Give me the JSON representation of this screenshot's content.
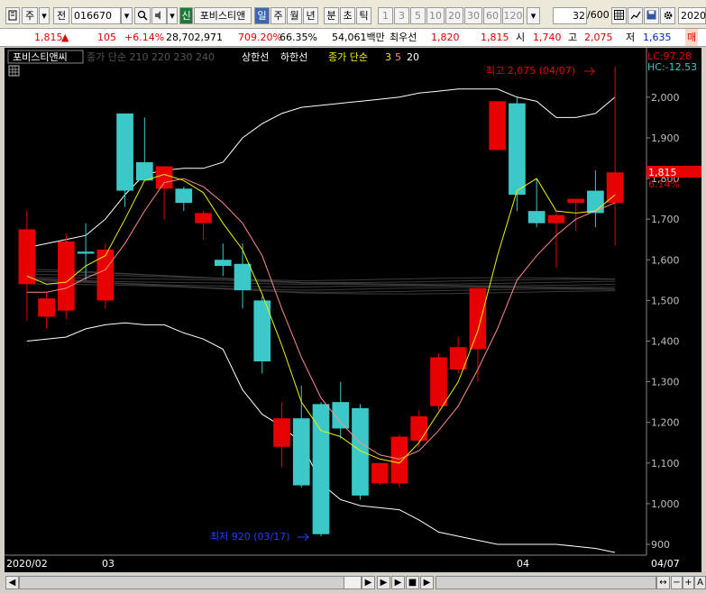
{
  "toolbar": {
    "market": "주",
    "type": "전",
    "code": "016670",
    "badge": "신",
    "name": "포비스티앤",
    "periods": [
      "일",
      "주",
      "월",
      "년",
      "분",
      "초",
      "틱"
    ],
    "minutes": [
      "1",
      "3",
      "5",
      "10",
      "20",
      "30",
      "60",
      "120"
    ],
    "count": "32",
    "count_total": "/600",
    "date": "2020"
  },
  "quote": {
    "price": "1,815",
    "arrow": "▲",
    "change": "105",
    "change_pct": "+6.14%",
    "volume": "28,702,971",
    "volume_pct": "709.20%",
    "ratio": "66.35%",
    "amount": "54,061백만",
    "best_ask_label": "최우선",
    "best_ask": "1,820",
    "best_bid": "1,815",
    "open_label": "시",
    "open": "1,740",
    "high_label": "고",
    "high": "2,075",
    "low_label": "저",
    "low": "1,635",
    "extra": "매"
  },
  "chart": {
    "legend_title": "포비스티앤씨",
    "legend_sma": "종가 단순 210 220 230 240",
    "legend_limit_up": "상한선",
    "legend_limit_down": "하한선",
    "legend_ma_label": "종가 단순",
    "legend_ma_periods": [
      "3",
      "5",
      "20"
    ],
    "lc": "LC:97.28",
    "hc": "HC:-12.53",
    "hi_note": "최고 2,075 (04/07)",
    "lo_note": "최저 920 (03/17)",
    "cur_price": "1,815",
    "cur_pct": "6.14%",
    "x_labels": [
      "2020/02",
      "03",
      "04",
      "04/07"
    ]
  },
  "colors": {
    "up": "#e60000",
    "down": "#3cc8c8",
    "ma3": "#f0f000",
    "ma5": "#ff8a8a",
    "band": "#ffffff",
    "axis": "#bfbfbf"
  },
  "chart_data": {
    "type": "candlestick",
    "y_ticks": [
      900,
      1000,
      1100,
      1200,
      1300,
      1400,
      1500,
      1600,
      1700,
      1800,
      1900,
      2000
    ],
    "y_range": [
      880,
      2095
    ],
    "candles": [
      {
        "o": 1540,
        "h": 1720,
        "l": 1450,
        "c": 1675
      },
      {
        "o": 1460,
        "h": 1520,
        "l": 1430,
        "c": 1505
      },
      {
        "o": 1475,
        "h": 1665,
        "l": 1455,
        "c": 1645
      },
      {
        "o": 1620,
        "h": 1690,
        "l": 1550,
        "c": 1615
      },
      {
        "o": 1500,
        "h": 1640,
        "l": 1480,
        "c": 1625
      },
      {
        "o": 1960,
        "h": 1960,
        "l": 1730,
        "c": 1770
      },
      {
        "o": 1840,
        "h": 1950,
        "l": 1800,
        "c": 1795
      },
      {
        "o": 1775,
        "h": 1830,
        "l": 1700,
        "c": 1830
      },
      {
        "o": 1775,
        "h": 1780,
        "l": 1720,
        "c": 1740
      },
      {
        "o": 1690,
        "h": 1720,
        "l": 1650,
        "c": 1715
      },
      {
        "o": 1600,
        "h": 1640,
        "l": 1560,
        "c": 1585
      },
      {
        "o": 1590,
        "h": 1640,
        "l": 1480,
        "c": 1525
      },
      {
        "o": 1500,
        "h": 1510,
        "l": 1320,
        "c": 1350
      },
      {
        "o": 1140,
        "h": 1250,
        "l": 1090,
        "c": 1210
      },
      {
        "o": 1210,
        "h": 1290,
        "l": 1040,
        "c": 1045
      },
      {
        "o": 1245,
        "h": 1250,
        "l": 920,
        "c": 925
      },
      {
        "o": 1250,
        "h": 1300,
        "l": 1160,
        "c": 1185
      },
      {
        "o": 1235,
        "h": 1245,
        "l": 1010,
        "c": 1020
      },
      {
        "o": 1050,
        "h": 1100,
        "l": 1045,
        "c": 1100
      },
      {
        "o": 1050,
        "h": 1170,
        "l": 1040,
        "c": 1165
      },
      {
        "o": 1155,
        "h": 1230,
        "l": 1140,
        "c": 1215
      },
      {
        "o": 1240,
        "h": 1370,
        "l": 1230,
        "c": 1360
      },
      {
        "o": 1330,
        "h": 1410,
        "l": 1320,
        "c": 1385
      },
      {
        "o": 1380,
        "h": 1530,
        "l": 1300,
        "c": 1530
      },
      {
        "o": 1870,
        "h": 1990,
        "l": 1870,
        "c": 1990
      },
      {
        "o": 1985,
        "h": 2000,
        "l": 1720,
        "c": 1760
      },
      {
        "o": 1720,
        "h": 1800,
        "l": 1680,
        "c": 1690
      },
      {
        "o": 1690,
        "h": 1720,
        "l": 1580,
        "c": 1710
      },
      {
        "o": 1740,
        "h": 1750,
        "l": 1670,
        "c": 1750
      },
      {
        "o": 1770,
        "h": 1820,
        "l": 1680,
        "c": 1715
      },
      {
        "o": 1740,
        "h": 2075,
        "l": 1635,
        "c": 1815
      }
    ],
    "ma3": [
      1560,
      1540,
      1545,
      1585,
      1610,
      1700,
      1795,
      1810,
      1795,
      1765,
      1690,
      1625,
      1515,
      1390,
      1250,
      1180,
      1165,
      1130,
      1110,
      1100,
      1150,
      1225,
      1300,
      1425,
      1610,
      1770,
      1800,
      1720,
      1715,
      1720,
      1760
    ],
    "ma5": [
      1520,
      1520,
      1530,
      1555,
      1575,
      1640,
      1720,
      1790,
      1800,
      1780,
      1740,
      1690,
      1610,
      1480,
      1360,
      1260,
      1200,
      1150,
      1120,
      1110,
      1130,
      1180,
      1240,
      1330,
      1430,
      1550,
      1610,
      1660,
      1700,
      1720,
      1740
    ],
    "band_upper": [
      1630,
      1640,
      1650,
      1660,
      1700,
      1760,
      1810,
      1820,
      1825,
      1825,
      1840,
      1900,
      1935,
      1960,
      1975,
      1980,
      1985,
      1990,
      1995,
      2000,
      2010,
      2015,
      2020,
      2020,
      2020,
      2000,
      1990,
      1950,
      1950,
      1960,
      2000
    ],
    "band_lower": [
      1400,
      1405,
      1410,
      1430,
      1440,
      1445,
      1440,
      1440,
      1420,
      1405,
      1380,
      1280,
      1220,
      1190,
      1150,
      1050,
      1010,
      995,
      990,
      985,
      960,
      930,
      920,
      910,
      900,
      900,
      900,
      900,
      895,
      890,
      880
    ]
  }
}
